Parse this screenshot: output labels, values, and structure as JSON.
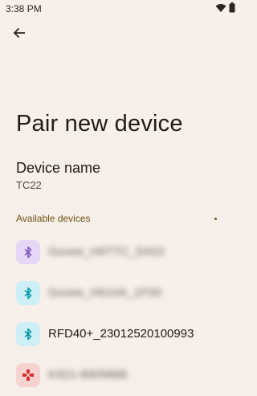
{
  "status_bar": {
    "time": "3:38 PM"
  },
  "header": {
    "back_label": "Back"
  },
  "page": {
    "title": "Pair new device"
  },
  "device_name": {
    "label": "Device name",
    "value": "TC22"
  },
  "available": {
    "header": "Available devices",
    "devices": [
      {
        "name": "Govee_H6TTC_5A53",
        "icon": "bluetooth-icon",
        "obscured": true,
        "color": "#7e57c2"
      },
      {
        "name": "Govee_H610A_1F00",
        "icon": "bluetooth-icon",
        "obscured": true,
        "color": "#0097a7"
      },
      {
        "name": "RFD40+_23012520100993",
        "icon": "bluetooth-icon",
        "obscured": false,
        "color": "#0097a7"
      },
      {
        "name": "K921-8909888",
        "icon": "gamepad-icon",
        "obscured": true,
        "color": "#d32f2f"
      }
    ]
  }
}
